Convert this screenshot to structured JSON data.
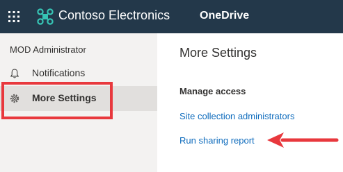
{
  "header": {
    "brand": "Contoso Electronics",
    "app_name": "OneDrive",
    "waffle_icon": "app-launcher-icon",
    "logo_icon": "contoso-logo-icon"
  },
  "sidebar": {
    "user_name": "MOD Administrator",
    "items": [
      {
        "label": "Notifications",
        "icon": "bell-icon"
      },
      {
        "label": "More Settings",
        "icon": "gear-icon",
        "selected": true
      }
    ]
  },
  "main": {
    "title": "More Settings",
    "section_title": "Manage access",
    "links": [
      {
        "label": "Site collection administrators"
      },
      {
        "label": "Run sharing report"
      }
    ]
  },
  "colors": {
    "header_bg": "#23384a",
    "sidebar_bg": "#f3f2f1",
    "selected_bg": "#e1dfdd",
    "link": "#0f6cbd",
    "annotation_red": "#e8383d",
    "logo_teal": "#36c3b4"
  }
}
